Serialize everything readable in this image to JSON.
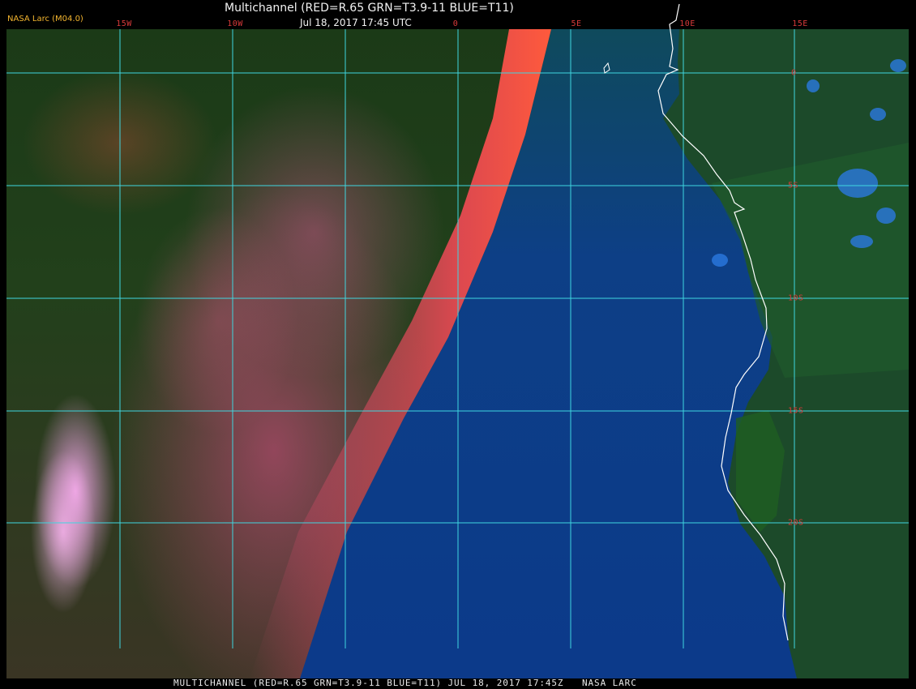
{
  "header": {
    "title": "Multichannel (RED=R.65 GRN=T3.9-11 BLUE=T11)",
    "subtitle": "Jul 18, 2017 17:45 UTC",
    "badge": "NASA Larc (M04.0)"
  },
  "longitude_labels": [
    "15W",
    "10W",
    "0",
    "5E",
    "10E",
    "15E"
  ],
  "latitude_labels": [
    "0",
    "5S",
    "10S",
    "15S",
    "20S"
  ],
  "footer": {
    "text": "MULTICHANNEL (RED=R.65 GRN=T3.9-11 BLUE=T11) JUL 18, 2017 17:45Z   NASA LARC"
  },
  "colors": {
    "grid": "#3fd6e0",
    "coastline": "#ffffff",
    "tick_label": "#d83a3a",
    "badge": "#f3b52f",
    "land": "#1d4a22",
    "ocean": "#0c3e8c",
    "sunlit_clouds": "#f04d7a"
  }
}
